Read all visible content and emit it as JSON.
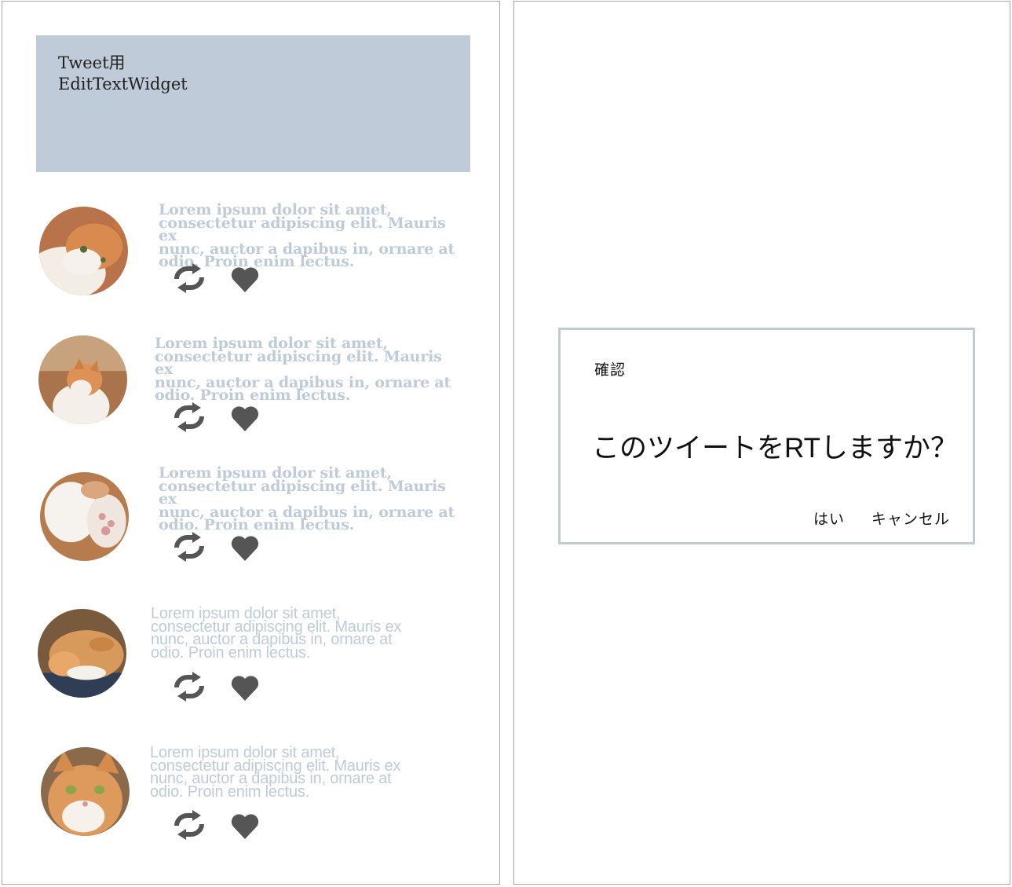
{
  "left_screen": {
    "edit_widget": {
      "line1": "Tweet用",
      "line2": "EditTextWidget"
    },
    "tweets": [
      {
        "avatar_icon": "cat-photo",
        "text_lines": [
          "Lorem ipsum dolor sit amet,",
          "consectetur adipiscing elit. Mauris ex",
          "nunc, auctor a dapibus in, ornare at",
          "odio. Proin enim lectus."
        ]
      },
      {
        "avatar_icon": "cat-photo",
        "text_lines": [
          "Lorem ipsum dolor sit amet,",
          "consectetur adipiscing elit. Mauris ex",
          "nunc, auctor a dapibus in, ornare at",
          "odio. Proin enim lectus."
        ]
      },
      {
        "avatar_icon": "cat-photo",
        "text_lines": [
          "Lorem ipsum dolor sit amet,",
          "consectetur adipiscing elit. Mauris ex",
          "nunc, auctor a dapibus in, ornare at",
          "odio. Proin enim lectus."
        ]
      },
      {
        "avatar_icon": "cat-photo",
        "text_lines": [
          "Lorem ipsum dolor sit amet,",
          "consectetur adipiscing elit. Mauris ex",
          "nunc, auctor a dapibus in, ornare at",
          "odio. Proin enim lectus."
        ]
      },
      {
        "avatar_icon": "cat-photo",
        "text_lines": [
          "Lorem ipsum dolor sit amet,",
          "consectetur adipiscing elit. Mauris ex",
          "nunc, auctor a dapibus in, ornare at",
          "odio. Proin enim lectus."
        ]
      }
    ],
    "icons": {
      "retweet": "retweet-icon",
      "like": "heart-icon"
    },
    "colors": {
      "accent": "#bfcbd9",
      "icon": "#555555",
      "border": "#a8a8a8"
    }
  },
  "right_screen": {
    "dialog": {
      "title": "確認",
      "message": "このツイートをRTしますか？",
      "yes_label": "はい",
      "cancel_label": "キャンセル"
    }
  }
}
